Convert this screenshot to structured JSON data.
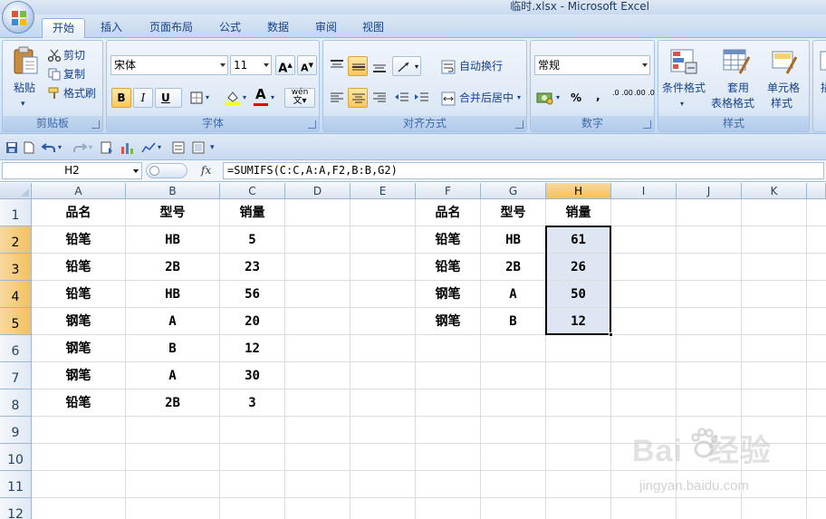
{
  "app": {
    "title": "临时.xlsx - Microsoft Excel"
  },
  "tabs": [
    {
      "label": "开始",
      "active": true
    },
    {
      "label": "插入"
    },
    {
      "label": "页面布局"
    },
    {
      "label": "公式"
    },
    {
      "label": "数据"
    },
    {
      "label": "审阅"
    },
    {
      "label": "视图"
    }
  ],
  "ribbon": {
    "clipboard": {
      "label": "剪贴板",
      "paste": "粘贴",
      "cut": "剪切",
      "copy": "复制",
      "format_painter": "格式刷"
    },
    "font": {
      "label": "字体",
      "name": "宋体",
      "size": "11",
      "bold": "B",
      "italic": "I",
      "underline": "U",
      "grow": "A",
      "shrink": "A",
      "color_a": "A",
      "wen": "wén"
    },
    "alignment": {
      "label": "对齐方式",
      "wrap": "自动换行",
      "merge": "合并后居中"
    },
    "number": {
      "label": "数字",
      "format": "常规",
      "percent": "%",
      "comma": ",",
      "inc_dec": ".0 .00",
      "dec_dec": ".00 .0"
    },
    "styles": {
      "label": "样式",
      "cond_line1": "条件格式",
      "table_line1": "套用",
      "table_line2": "表格格式",
      "cell_line1": "单元格",
      "cell_line2": "样式"
    },
    "cut_right": "插"
  },
  "formula_bar": {
    "name_box": "H2",
    "fx": "fx",
    "formula": "=SUMIFS(C:C,A:A,F2,B:B,G2)"
  },
  "sheet": {
    "columns": [
      "A",
      "B",
      "C",
      "D",
      "E",
      "F",
      "G",
      "H",
      "I",
      "J",
      "K"
    ],
    "selected_column": "H",
    "rows": [
      "1",
      "2",
      "3",
      "4",
      "5",
      "6",
      "7",
      "8",
      "9",
      "10",
      "11",
      "12"
    ],
    "selected_rows": [
      "2",
      "3",
      "4",
      "5"
    ],
    "cells": {
      "A1": "品名",
      "B1": "型号",
      "C1": "销量",
      "A2": "铅笔",
      "B2": "HB",
      "C2": "5",
      "A3": "铅笔",
      "B3": "2B",
      "C3": "23",
      "A4": "铅笔",
      "B4": "HB",
      "C4": "56",
      "A5": "钢笔",
      "B5": "A",
      "C5": "20",
      "A6": "钢笔",
      "B6": "B",
      "C6": "12",
      "A7": "钢笔",
      "B7": "A",
      "C7": "30",
      "A8": "铅笔",
      "B8": "2B",
      "C8": "3",
      "F1": "品名",
      "G1": "型号",
      "H1": "销量",
      "F2": "铅笔",
      "G2": "HB",
      "H2": "61",
      "F3": "铅笔",
      "G3": "2B",
      "H3": "26",
      "F4": "钢笔",
      "G4": "A",
      "H4": "50",
      "F5": "钢笔",
      "G5": "B",
      "H5": "12"
    }
  },
  "watermark": {
    "brand": "Bai du 经验",
    "url": "jingyan.baidu.com"
  },
  "colors": {
    "selection_fill": "#dfe6f3",
    "header_selected": "#f1c15f",
    "ribbon_text": "#15428b"
  }
}
